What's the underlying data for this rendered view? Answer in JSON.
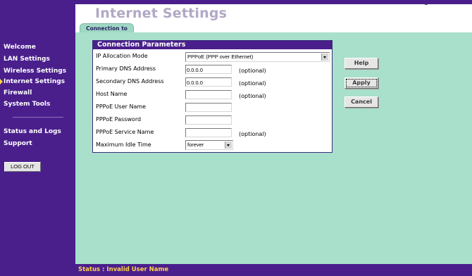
{
  "page": {
    "title": "Internet Settings",
    "tab": "Connection to ISP"
  },
  "sidebar": {
    "items": [
      {
        "label": "Welcome"
      },
      {
        "label": "LAN Settings"
      },
      {
        "label": "Wireless Settings"
      },
      {
        "label": "Internet Settings",
        "active": true
      },
      {
        "label": "Firewall"
      },
      {
        "label": "System Tools"
      },
      {
        "label": "Status and Logs"
      },
      {
        "label": "Support"
      }
    ],
    "logout_label": "LOG OUT"
  },
  "panel": {
    "header": "Connection Parameters",
    "ip_mode": {
      "label": "IP Allocation Mode",
      "value": "PPPoE (PPP over Ethernet)"
    },
    "primary_dns": {
      "label": "Primary DNS Address",
      "value": "0.0.0.0",
      "note": "(optional)"
    },
    "secondary_dns": {
      "label": "Secondary DNS Address",
      "value": "0.0.0.0",
      "note": "(optional)"
    },
    "host_name": {
      "label": "Host Name",
      "value": "",
      "note": "(optional)"
    },
    "pppoe_user": {
      "label": "PPPoE User Name",
      "value": ""
    },
    "pppoe_password": {
      "label": "PPPoE Password",
      "value": ""
    },
    "pppoe_service": {
      "label": "PPPoE Service Name",
      "value": "",
      "note": "(optional)"
    },
    "idle_time": {
      "label": "Maximum Idle Time",
      "value": "forever"
    }
  },
  "buttons": {
    "help": "Help",
    "apply": "Apply",
    "cancel": "Cancel"
  },
  "status": {
    "text": "Status : Invalid User Name"
  },
  "colors": {
    "sidebar": "#4a1f8c",
    "content": "#a9e0cb",
    "status_text": "#ffd34a",
    "title": "#b2a8c6"
  }
}
